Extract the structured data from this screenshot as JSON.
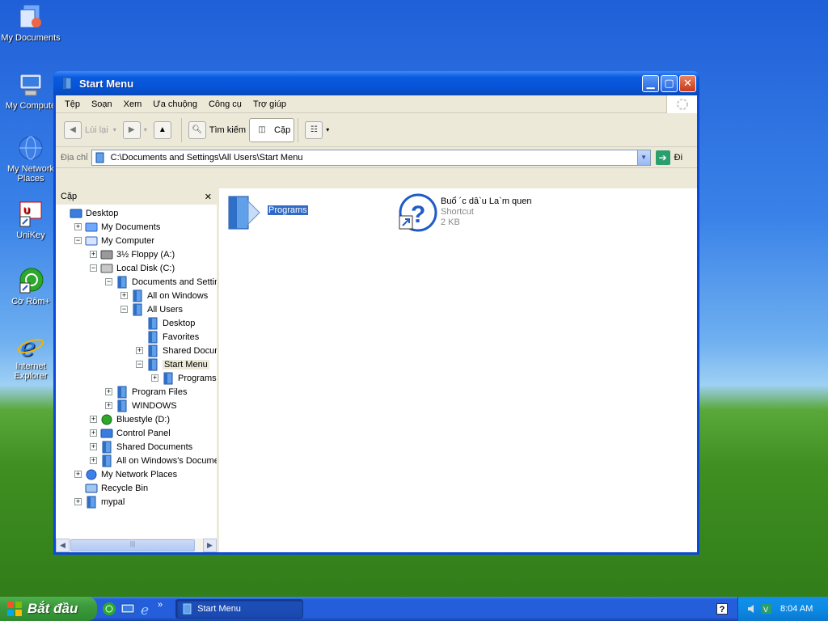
{
  "desktop": {
    "icons": [
      {
        "label": "My Documents"
      },
      {
        "label": "My Compute"
      },
      {
        "label": "My Network Places"
      },
      {
        "label": "UniKey"
      },
      {
        "label": "Cờ Rôm+"
      },
      {
        "label": "Internet Explorer"
      }
    ]
  },
  "window": {
    "title": "Start Menu",
    "menu": [
      "Tệp",
      "Soạn",
      "Xem",
      "Ưa chuộng",
      "Công cụ",
      "Trợ giúp"
    ],
    "toolbar": {
      "back_label": "Lùi lại",
      "search_label": "Tìm kiếm",
      "folders_label": "Cặp"
    },
    "address": {
      "label": "Địa chỉ",
      "value": "C:\\Documents and Settings\\All Users\\Start Menu",
      "go_label": "Đi"
    },
    "folders_pane": {
      "title": "Cặp",
      "close_glyph": "✕",
      "tree": [
        {
          "label": "Desktop",
          "level": 0,
          "exp": "",
          "icon": "desktop-icon"
        },
        {
          "label": "My Documents",
          "level": 1,
          "exp": "+",
          "icon": "my-documents-icon"
        },
        {
          "label": "My Computer",
          "level": 1,
          "exp": "−",
          "icon": "my-computer-icon"
        },
        {
          "label": "3½ Floppy (A:)",
          "level": 2,
          "exp": "+",
          "icon": "floppy-icon"
        },
        {
          "label": "Local Disk (C:)",
          "level": 2,
          "exp": "−",
          "icon": "disk-icon"
        },
        {
          "label": "Documents and Settings",
          "level": 3,
          "exp": "−",
          "icon": "folder-icon"
        },
        {
          "label": "All on Windows",
          "level": 4,
          "exp": "+",
          "icon": "folder-icon"
        },
        {
          "label": "All Users",
          "level": 4,
          "exp": "−",
          "icon": "folder-icon"
        },
        {
          "label": "Desktop",
          "level": 5,
          "exp": "",
          "icon": "folder-icon"
        },
        {
          "label": "Favorites",
          "level": 5,
          "exp": "",
          "icon": "folder-icon"
        },
        {
          "label": "Shared Document",
          "level": 5,
          "exp": "+",
          "icon": "folder-icon"
        },
        {
          "label": "Start Menu",
          "level": 5,
          "exp": "−",
          "icon": "folder-icon",
          "selected": true
        },
        {
          "label": "Programs",
          "level": 6,
          "exp": "+",
          "icon": "folder-icon"
        },
        {
          "label": "Program Files",
          "level": 3,
          "exp": "+",
          "icon": "folder-icon"
        },
        {
          "label": "WINDOWS",
          "level": 3,
          "exp": "+",
          "icon": "folder-icon"
        },
        {
          "label": "Bluestyle (D:)",
          "level": 2,
          "exp": "+",
          "icon": "cd-drive-icon"
        },
        {
          "label": "Control Panel",
          "level": 2,
          "exp": "+",
          "icon": "control-panel-icon"
        },
        {
          "label": "Shared Documents",
          "level": 2,
          "exp": "+",
          "icon": "folder-icon"
        },
        {
          "label": "All on Windows's Documents",
          "level": 2,
          "exp": "+",
          "icon": "folder-icon"
        },
        {
          "label": "My Network Places",
          "level": 1,
          "exp": "+",
          "icon": "network-icon"
        },
        {
          "label": "Recycle Bin",
          "level": 1,
          "exp": "",
          "icon": "recycle-bin-icon"
        },
        {
          "label": "mypal",
          "level": 1,
          "exp": "+",
          "icon": "folder-icon"
        }
      ]
    },
    "files": [
      {
        "name": "Programs",
        "type": "",
        "size": "",
        "icon": "folder-icon",
        "selected": true
      },
      {
        "name": "Buổ ´c dâ`u La`m quen",
        "type": "Shortcut",
        "size": "2 KB",
        "icon": "help-shortcut-icon"
      }
    ]
  },
  "taskbar": {
    "start_label": "Bắt đầu",
    "task_label": "Start Menu",
    "clock": "8:04 AM",
    "chevron": "»"
  },
  "colors": {
    "title_blue": "#0a5be0",
    "selection": "#316ac5",
    "start_green": "#3c9a3c"
  }
}
